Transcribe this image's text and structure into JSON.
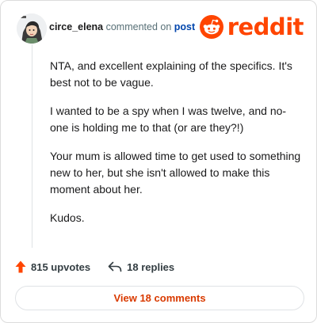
{
  "comment": {
    "author": "circe_elena",
    "action_text": "commented on",
    "post_link": "post",
    "paragraphs": [
      "NTA, and excellent explaining of the specifics. It's best not to be vague.",
      "I wanted to be a spy when I was twelve, and no-one is holding me to that (or are they?!)",
      "Your mum is allowed time to get used to something new to her, but she isn't allowed to make this moment about her.",
      "Kudos."
    ]
  },
  "brand": {
    "name": "reddit",
    "color": "#ff4500"
  },
  "footer": {
    "upvotes_label": "815 upvotes",
    "replies_label": "18 replies",
    "view_comments_label": "View 18 comments"
  },
  "icons": {
    "upvote": "upvote-arrow-icon",
    "reply": "reply-arrow-icon",
    "brand": "reddit-snoo-icon"
  }
}
